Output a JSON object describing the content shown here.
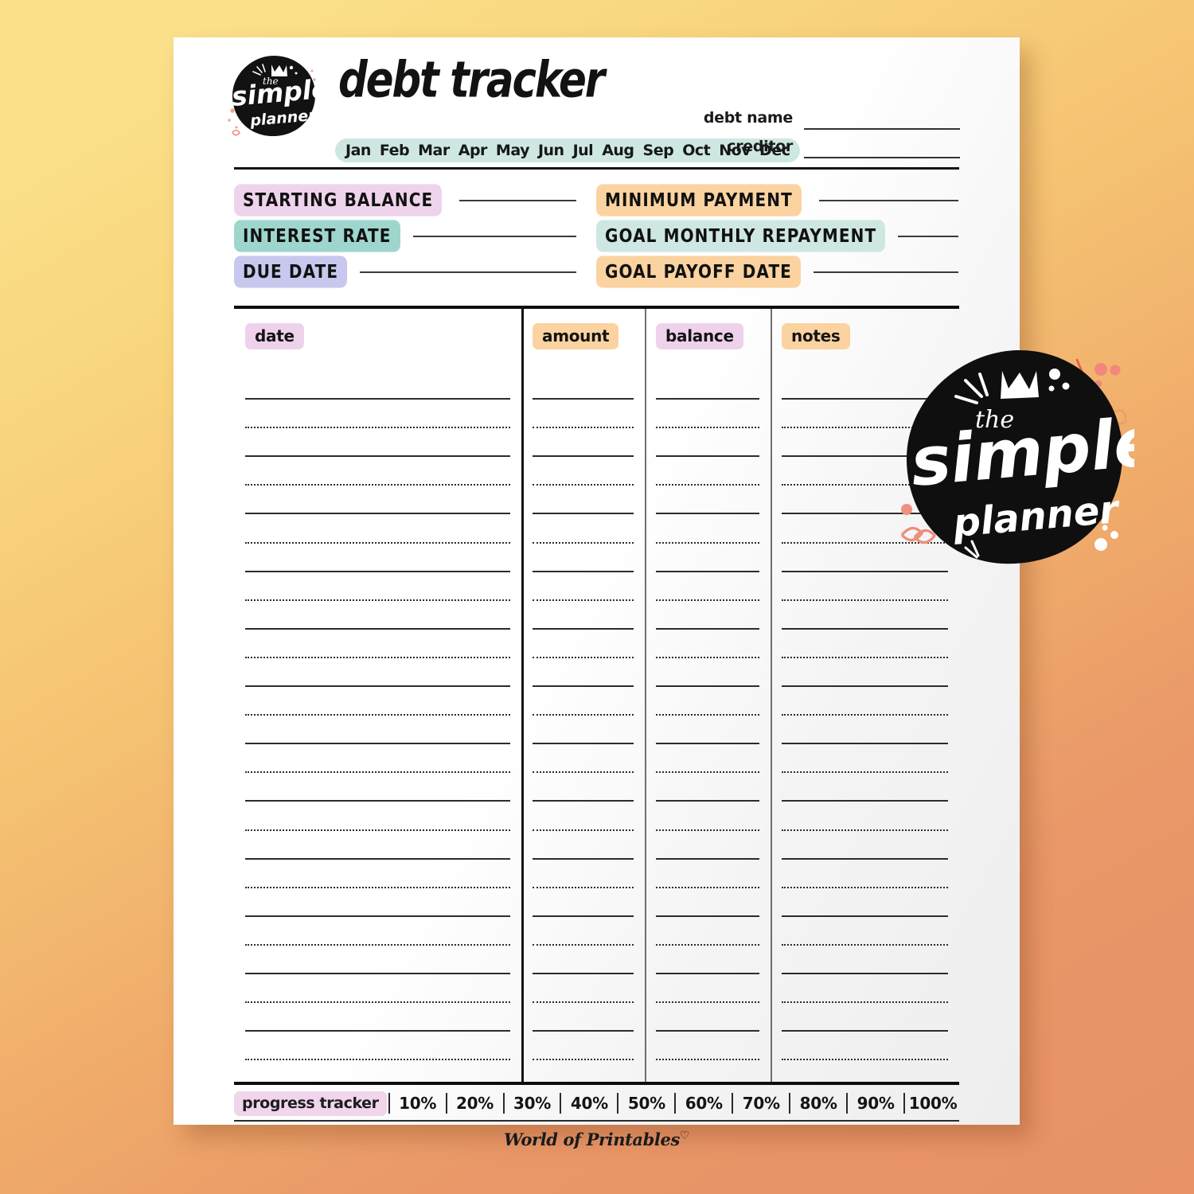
{
  "brand": {
    "logo_line1": "the",
    "logo_line2": "simple",
    "logo_line3": "planner",
    "footer": "World of Printables",
    "footer_heart": "♡"
  },
  "header": {
    "title": "debt tracker",
    "months": [
      "Jan",
      "Feb",
      "Mar",
      "Apr",
      "May",
      "Jun",
      "Jul",
      "Aug",
      "Sep",
      "Oct",
      "Nov",
      "Dec"
    ],
    "fields": [
      {
        "label": "debt name",
        "value": ""
      },
      {
        "label": "creditor",
        "value": ""
      }
    ]
  },
  "summary": {
    "left": [
      {
        "label": "STARTING BALANCE",
        "color": "#efd3ec",
        "value": ""
      },
      {
        "label": "INTEREST RATE",
        "color": "#9ed6ce",
        "value": ""
      },
      {
        "label": "DUE DATE",
        "color": "#c8c8ef",
        "value": ""
      }
    ],
    "right": [
      {
        "label": "MINIMUM PAYMENT",
        "color": "#fbd3a0",
        "value": ""
      },
      {
        "label": "GOAL MONTHLY REPAYMENT",
        "color": "#cfe7e3",
        "value": ""
      },
      {
        "label": "GOAL PAYOFF DATE",
        "color": "#fbd3a0",
        "value": ""
      }
    ]
  },
  "table": {
    "columns": [
      {
        "label": "date",
        "color": "#eed2ec"
      },
      {
        "label": "amount",
        "color": "#fbd3a0"
      },
      {
        "label": "balance",
        "color": "#eed2ec"
      },
      {
        "label": "notes",
        "color": "#fbd3a0"
      }
    ],
    "row_count": 24,
    "rows": [
      {
        "date": "",
        "amount": "",
        "balance": "",
        "notes": ""
      },
      {
        "date": "",
        "amount": "",
        "balance": "",
        "notes": ""
      },
      {
        "date": "",
        "amount": "",
        "balance": "",
        "notes": ""
      },
      {
        "date": "",
        "amount": "",
        "balance": "",
        "notes": ""
      },
      {
        "date": "",
        "amount": "",
        "balance": "",
        "notes": ""
      },
      {
        "date": "",
        "amount": "",
        "balance": "",
        "notes": ""
      },
      {
        "date": "",
        "amount": "",
        "balance": "",
        "notes": ""
      },
      {
        "date": "",
        "amount": "",
        "balance": "",
        "notes": ""
      },
      {
        "date": "",
        "amount": "",
        "balance": "",
        "notes": ""
      },
      {
        "date": "",
        "amount": "",
        "balance": "",
        "notes": ""
      },
      {
        "date": "",
        "amount": "",
        "balance": "",
        "notes": ""
      },
      {
        "date": "",
        "amount": "",
        "balance": "",
        "notes": ""
      },
      {
        "date": "",
        "amount": "",
        "balance": "",
        "notes": ""
      },
      {
        "date": "",
        "amount": "",
        "balance": "",
        "notes": ""
      },
      {
        "date": "",
        "amount": "",
        "balance": "",
        "notes": ""
      },
      {
        "date": "",
        "amount": "",
        "balance": "",
        "notes": ""
      },
      {
        "date": "",
        "amount": "",
        "balance": "",
        "notes": ""
      },
      {
        "date": "",
        "amount": "",
        "balance": "",
        "notes": ""
      },
      {
        "date": "",
        "amount": "",
        "balance": "",
        "notes": ""
      },
      {
        "date": "",
        "amount": "",
        "balance": "",
        "notes": ""
      },
      {
        "date": "",
        "amount": "",
        "balance": "",
        "notes": ""
      },
      {
        "date": "",
        "amount": "",
        "balance": "",
        "notes": ""
      },
      {
        "date": "",
        "amount": "",
        "balance": "",
        "notes": ""
      },
      {
        "date": "",
        "amount": "",
        "balance": "",
        "notes": ""
      }
    ]
  },
  "progress": {
    "label": "progress tracker",
    "label_color": "#f0d5ec",
    "steps": [
      "10%",
      "20%",
      "30%",
      "40%",
      "50%",
      "60%",
      "70%",
      "80%",
      "90%",
      "100%"
    ]
  },
  "colors": {
    "bg_start": "#fbe08a",
    "bg_end": "#e89167",
    "paper": "#ffffff",
    "ink": "#141414",
    "pink": "#efd3ec",
    "teal": "#9ed6ce",
    "mint": "#cfe7e3",
    "periwinkle": "#c8c8ef",
    "peach": "#fbd3a0",
    "coral": "#f08a78"
  }
}
